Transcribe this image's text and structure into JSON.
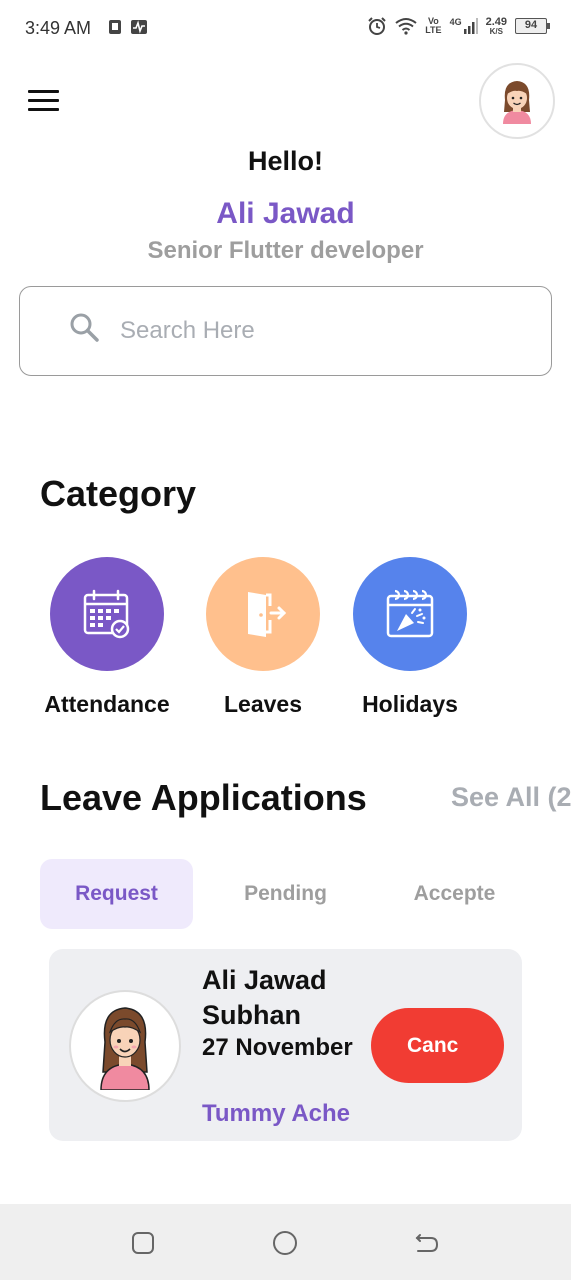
{
  "status_bar": {
    "time": "3:49 AM",
    "network_vo": "Vo",
    "network_lte": "LTE",
    "network_4g": "4G",
    "speed_value": "2.49",
    "speed_unit": "K/S",
    "battery": "94"
  },
  "header": {
    "greeting": "Hello!",
    "user_name": "Ali Jawad",
    "user_role": "Senior Flutter developer"
  },
  "search": {
    "placeholder": "Search Here",
    "value": ""
  },
  "category": {
    "title": "Category",
    "items": [
      {
        "label": "Attendance",
        "icon": "calendar-check-icon",
        "color": "#7a58c6"
      },
      {
        "label": "Leaves",
        "icon": "door-exit-icon",
        "color": "#ffc08d"
      },
      {
        "label": "Holidays",
        "icon": "party-popper-calendar-icon",
        "color": "#5683ec"
      }
    ]
  },
  "leave_applications": {
    "title": "Leave Applications",
    "see_all": "See All (2",
    "tabs": [
      "Request",
      "Pending",
      "Accepte"
    ],
    "active_tab": "Request",
    "cards": [
      {
        "name": "Ali Jawad Subhan",
        "date": "27 November",
        "reason": "Tummy Ache",
        "action": "Canc"
      }
    ]
  },
  "colors": {
    "primary": "#7a58c6",
    "cancel": "#f13c33",
    "muted": "#9e9e9e"
  }
}
